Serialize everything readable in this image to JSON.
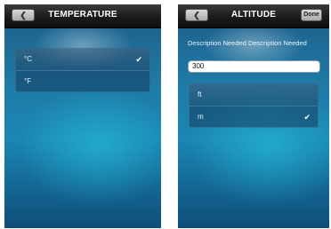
{
  "temperature_screen": {
    "title": "TEMPERATURE",
    "back_icon": "chevron-left-icon",
    "units": [
      {
        "label": "°C",
        "selected": true
      },
      {
        "label": "°F",
        "selected": false
      }
    ],
    "check_glyph": "✔"
  },
  "altitude_screen": {
    "title": "ALTITUDE",
    "back_icon": "chevron-left-icon",
    "done_label": "Done",
    "description": "Description Needed Description Needed",
    "input_value": "300",
    "units": [
      {
        "label": "ft",
        "selected": false
      },
      {
        "label": "m",
        "selected": true
      }
    ],
    "check_glyph": "✔"
  }
}
